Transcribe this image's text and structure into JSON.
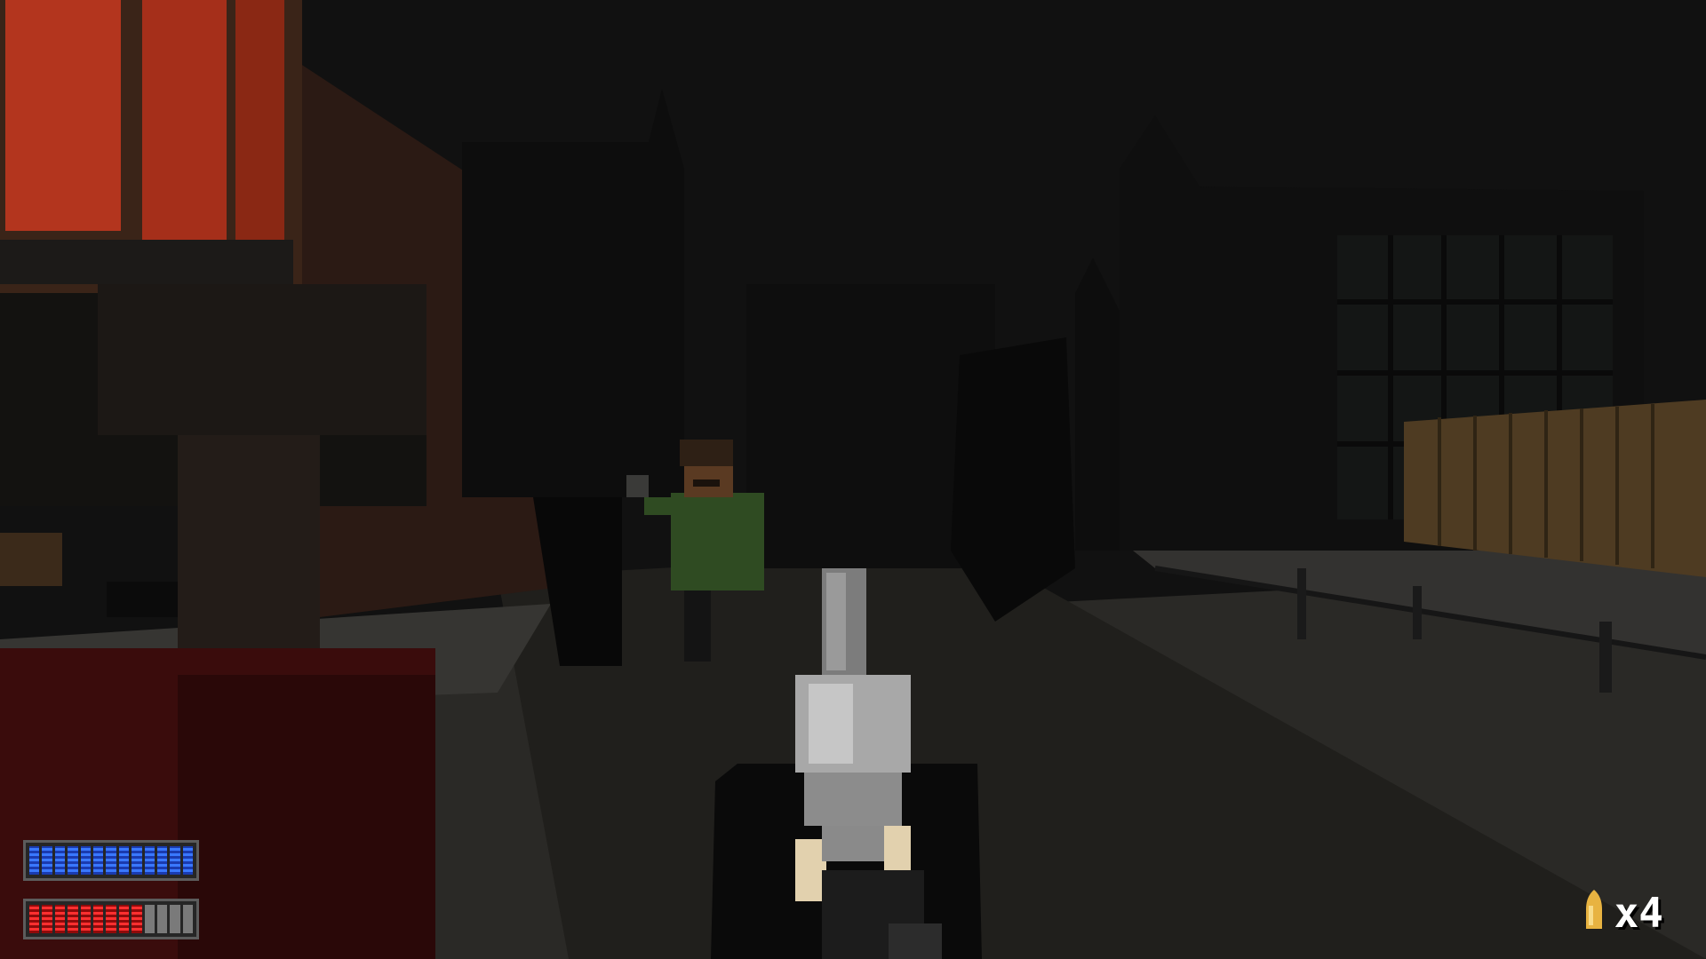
{
  "hud": {
    "armor": {
      "level": 1.0,
      "segments": 13,
      "color": "#2a5ce8"
    },
    "health": {
      "level": 0.7,
      "segments": 13,
      "color": "#d01818"
    },
    "ammo": {
      "count_text": "x4",
      "icon": "bullet-icon",
      "color": "#e8b341"
    }
  },
  "colors": {
    "sky": "#121212",
    "window_glow": "#b3351e",
    "fence": "#5a4428",
    "enemy_shirt": "#2f4b22"
  }
}
